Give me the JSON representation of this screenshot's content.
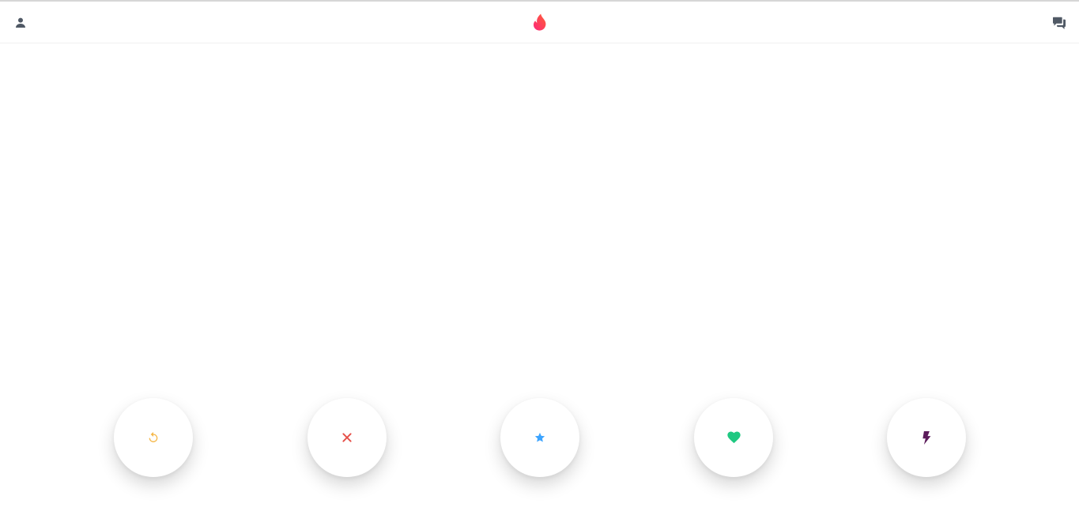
{
  "app": {
    "brand": "tinder",
    "accent_color": "#fd5068"
  },
  "header": {
    "profile_icon": "person-icon",
    "logo_icon": "flame-logo-icon",
    "messages_icon": "chat-bubbles-icon"
  },
  "actions": [
    {
      "id": "rewind",
      "icon": "rewind-icon",
      "color": "#f5b748"
    },
    {
      "id": "nope",
      "icon": "close-icon",
      "color": "#e54e47"
    },
    {
      "id": "super-like",
      "icon": "star-icon",
      "color": "#3ca4ff"
    },
    {
      "id": "like",
      "icon": "heart-icon",
      "color": "#1fc881"
    },
    {
      "id": "boost",
      "icon": "lightning-bolt-icon",
      "color": "#5b1b5a"
    }
  ]
}
